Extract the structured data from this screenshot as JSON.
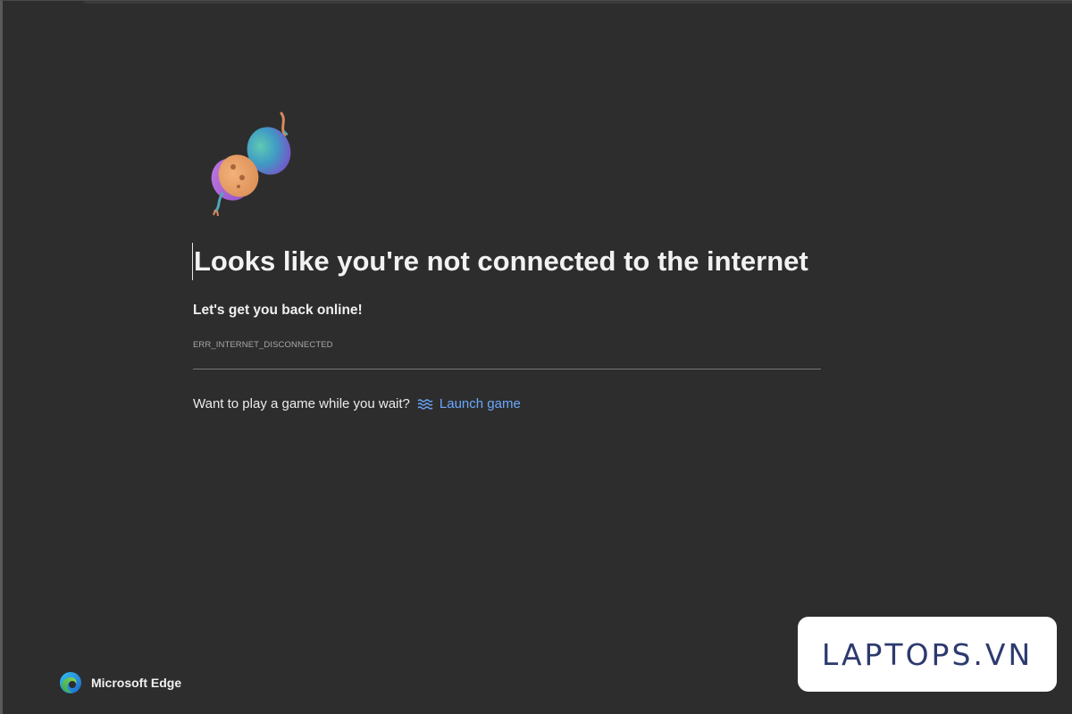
{
  "error_page": {
    "title": "Looks like you're not connected to the internet",
    "subtitle": "Let's get you back online!",
    "error_code": "ERR_INTERNET_DISCONNECTED",
    "game_prompt": "Want to play a game while you wait?",
    "launch_game_label": "Launch game",
    "illustration_icon": "unplugged-plug-icon",
    "link_color": "#6aa9ff"
  },
  "footer": {
    "brand_name": "Microsoft Edge",
    "brand_icon": "edge-logo-icon"
  },
  "watermark": {
    "text": "LAPTOPS.VN"
  },
  "colors": {
    "background": "#2d2d2d",
    "text": "#f2f2f2",
    "muted": "#a8a8a8",
    "divider": "#777777"
  }
}
